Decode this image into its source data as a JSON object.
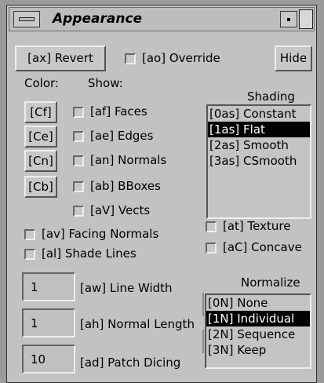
{
  "window": {
    "title": "Appearance"
  },
  "buttons": {
    "revert": "[ax] Revert",
    "hide": "Hide"
  },
  "override": {
    "label": "[ao] Override"
  },
  "headers": {
    "color": "Color:",
    "show": "Show:",
    "shading": "Shading",
    "normalize": "Normalize"
  },
  "color_buttons": [
    "[Cf]",
    "[Ce]",
    "[Cn]",
    "[Cb]"
  ],
  "show_items": [
    "[af] Faces",
    "[ae] Edges",
    "[an] Normals",
    "[ab] BBoxes",
    "[aV] Vects"
  ],
  "options": {
    "facing_normals": "[av] Facing Normals",
    "shade_lines": "[al] Shade Lines",
    "texture": "[at] Texture",
    "concave": "[aC] Concave"
  },
  "shading": {
    "items": [
      "[0as] Constant",
      "[1as] Flat",
      "[2as] Smooth",
      "[3as] CSmooth"
    ],
    "selected": "[1as] Flat"
  },
  "normalize": {
    "items": [
      "[0N] None",
      "[1N] Individual",
      "[2N] Sequence",
      "[3N] Keep"
    ],
    "selected": "[1N] Individual"
  },
  "fields": {
    "line_width": {
      "value": "1",
      "label": "[aw] Line Width"
    },
    "normal_length": {
      "value": "1",
      "label": "[ah] Normal Length"
    },
    "patch_dicing": {
      "value": "10",
      "label": "[ad] Patch Dicing"
    }
  }
}
